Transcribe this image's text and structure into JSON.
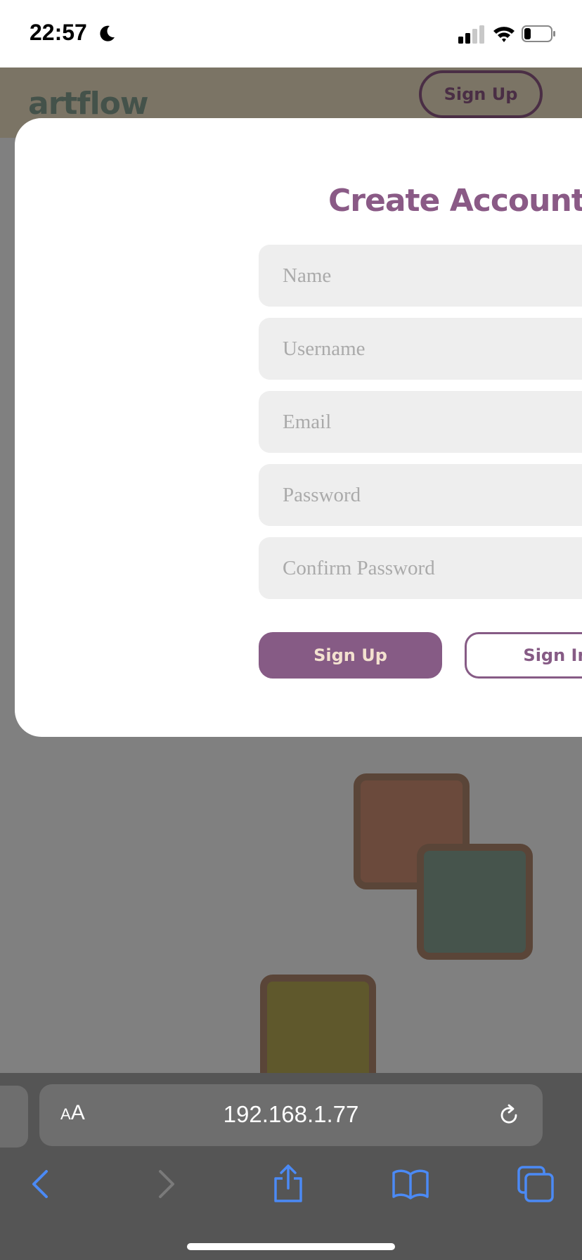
{
  "status_bar": {
    "time": "22:57",
    "icons": [
      "moon-icon",
      "signal-icon",
      "wifi-icon",
      "battery-icon"
    ]
  },
  "header": {
    "logo": "artflow",
    "signup_label": "Sign Up"
  },
  "modal": {
    "title": "Create Account",
    "fields": [
      {
        "name": "name",
        "placeholder": "Name"
      },
      {
        "name": "username",
        "placeholder": "Username"
      },
      {
        "name": "email",
        "placeholder": "Email"
      },
      {
        "name": "password",
        "placeholder": "Password"
      },
      {
        "name": "confirm-password",
        "placeholder": "Confirm Password"
      }
    ],
    "primary_button": "Sign Up",
    "secondary_button": "Sign In"
  },
  "browser": {
    "aa_small": "A",
    "aa_large": "A",
    "url": "192.168.1.77",
    "toolbar_icons": [
      "back-icon",
      "forward-icon",
      "share-icon",
      "bookmarks-icon",
      "tabs-icon"
    ]
  },
  "colors": {
    "accent": "#865b85",
    "button_text": "#f3e1cf",
    "overlay": "#808080",
    "tile_red": "#6b4a3c",
    "tile_green": "#46544c",
    "tile_olive": "#5f582c",
    "tile_border": "#5a4538"
  }
}
